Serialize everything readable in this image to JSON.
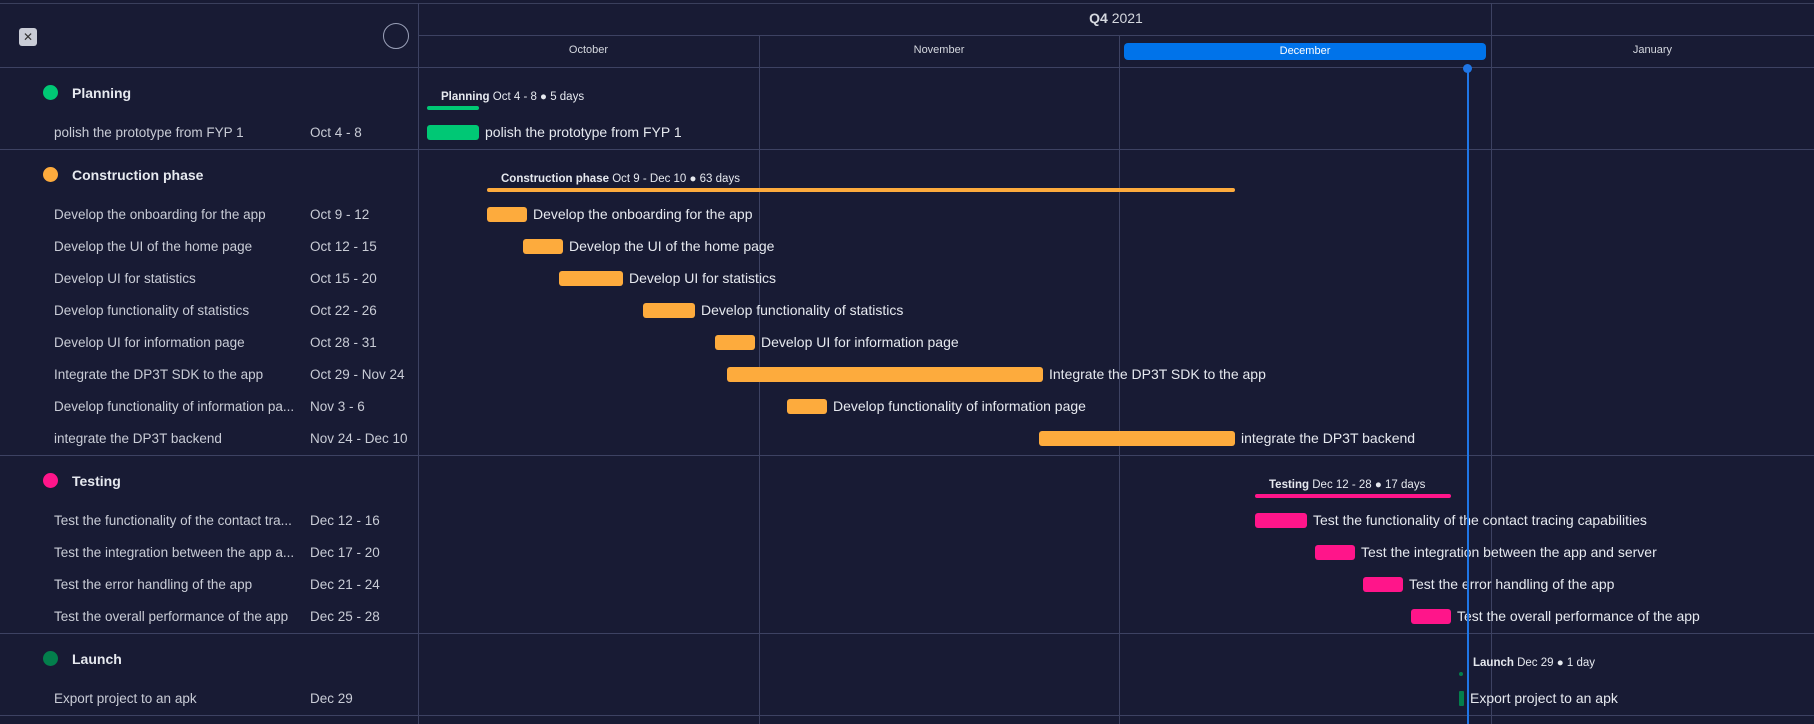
{
  "header": {
    "quarter": "Q4",
    "year": "2021",
    "months": [
      "October",
      "November",
      "December",
      "January"
    ],
    "active_month": "December",
    "collapse_icon": "collapse-arrows-icon",
    "circle_icon": "empty-circle-icon"
  },
  "groups": [
    {
      "name": "Planning",
      "color": "#00c875",
      "summary": {
        "name": "Planning",
        "info": "Oct 4 - 8 ● 5 days"
      },
      "tasks": [
        {
          "name": "polish the prototype from FYP 1",
          "dates": "Oct 4 - 8",
          "bar_label": "polish the prototype from FYP 1"
        }
      ]
    },
    {
      "name": "Construction phase",
      "color": "#fdab3d",
      "summary": {
        "name": "Construction phase",
        "info": "Oct 9 - Dec 10 ● 63 days"
      },
      "tasks": [
        {
          "name": "Develop the onboarding for the app",
          "dates": "Oct 9 - 12",
          "bar_label": "Develop the onboarding for the app"
        },
        {
          "name": "Develop the UI of the home page",
          "dates": "Oct 12 - 15",
          "bar_label": "Develop the UI of the home page"
        },
        {
          "name": "Develop UI for statistics",
          "dates": "Oct 15 - 20",
          "bar_label": "Develop UI for statistics"
        },
        {
          "name": "Develop functionality of statistics",
          "dates": "Oct 22 - 26",
          "bar_label": "Develop functionality of statistics"
        },
        {
          "name": "Develop UI for information page",
          "dates": "Oct 28 - 31",
          "bar_label": "Develop UI for information page"
        },
        {
          "name": "Integrate the DP3T SDK to the app",
          "dates": "Oct 29 - Nov 24",
          "bar_label": "Integrate the DP3T SDK to the app"
        },
        {
          "name": "Develop functionality of information pa...",
          "dates": "Nov 3 - 6",
          "bar_label": "Develop functionality of information page"
        },
        {
          "name": "integrate the DP3T backend",
          "dates": "Nov 24 - Dec 10",
          "bar_label": "integrate the DP3T backend"
        }
      ]
    },
    {
      "name": "Testing",
      "color": "#ff158a",
      "summary": {
        "name": "Testing",
        "info": "Dec 12 - 28 ● 17 days"
      },
      "tasks": [
        {
          "name": "Test the functionality of the contact tra...",
          "dates": "Dec 12 - 16",
          "bar_label": "Test the functionality of the contact tracing capabilities"
        },
        {
          "name": "Test the integration between the app a...",
          "dates": "Dec 17 - 20",
          "bar_label": "Test the integration between the app and server"
        },
        {
          "name": "Test the error handling of the app",
          "dates": "Dec 21 - 24",
          "bar_label": "Test the error handling of the app"
        },
        {
          "name": "Test the overall performance of the app",
          "dates": "Dec 25 - 28",
          "bar_label": "Test the overall performance of the app"
        }
      ]
    },
    {
      "name": "Launch",
      "color": "#037f4c",
      "summary": {
        "name": "Launch",
        "info": "Dec 29 ● 1 day"
      },
      "tasks": [
        {
          "name": "Export project to an apk",
          "dates": "Dec 29",
          "bar_label": "Export project to an apk"
        }
      ]
    }
  ]
}
